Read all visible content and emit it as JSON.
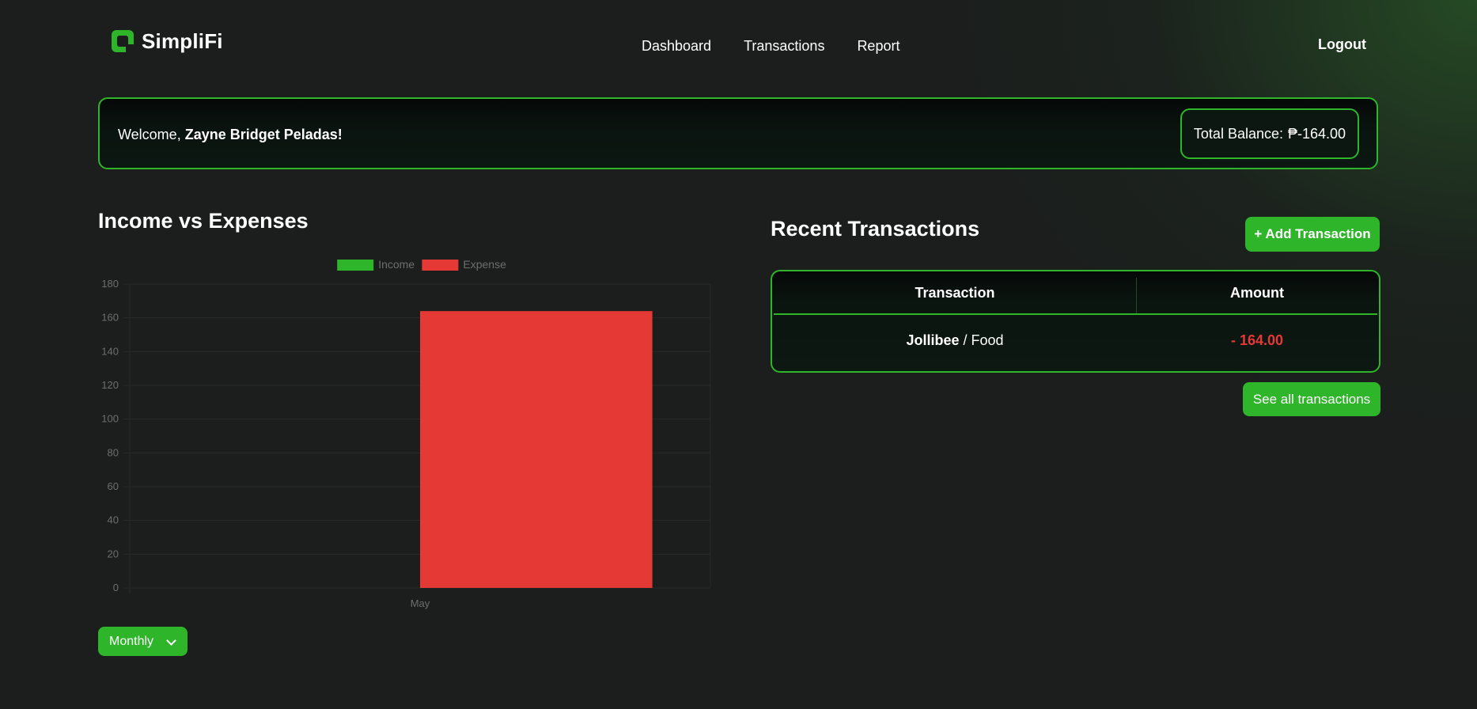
{
  "brand": {
    "name": "SimpliFi",
    "icon": "simplifi-logo-icon",
    "accent": "#2fb52a"
  },
  "nav": {
    "items": [
      {
        "label": "Dashboard"
      },
      {
        "label": "Transactions"
      },
      {
        "label": "Report"
      }
    ],
    "logout": "Logout"
  },
  "welcome": {
    "prefix": "Welcome,",
    "user_name": "Zayne Bridget Peladas!",
    "balance_label": "Total Balance:",
    "balance_value": "₱-164.00"
  },
  "chart_section": {
    "title": "Income vs Expenses",
    "period_select": {
      "selected": "Monthly",
      "icon": "chevron-down-icon"
    }
  },
  "chart_data": {
    "type": "bar",
    "categories": [
      "May"
    ],
    "series": [
      {
        "name": "Income",
        "values": [
          0
        ],
        "color": "#2fb52a"
      },
      {
        "name": "Expense",
        "values": [
          164
        ],
        "color": "#e53935"
      }
    ],
    "title": "",
    "xlabel": "",
    "ylabel": "",
    "ylim": [
      0,
      180
    ],
    "yticks": [
      0,
      20,
      40,
      60,
      80,
      100,
      120,
      140,
      160,
      180
    ],
    "grid": true,
    "legend": "top-center"
  },
  "transactions": {
    "title": "Recent Transactions",
    "add_button": "+ Add Transaction",
    "columns": [
      "Transaction",
      "Amount"
    ],
    "rows": [
      {
        "merchant": "Jollibee",
        "separator": "/",
        "category": "Food",
        "amount": "- 164.00",
        "amount_color": "#e53935"
      }
    ],
    "see_all": "See all transactions"
  }
}
